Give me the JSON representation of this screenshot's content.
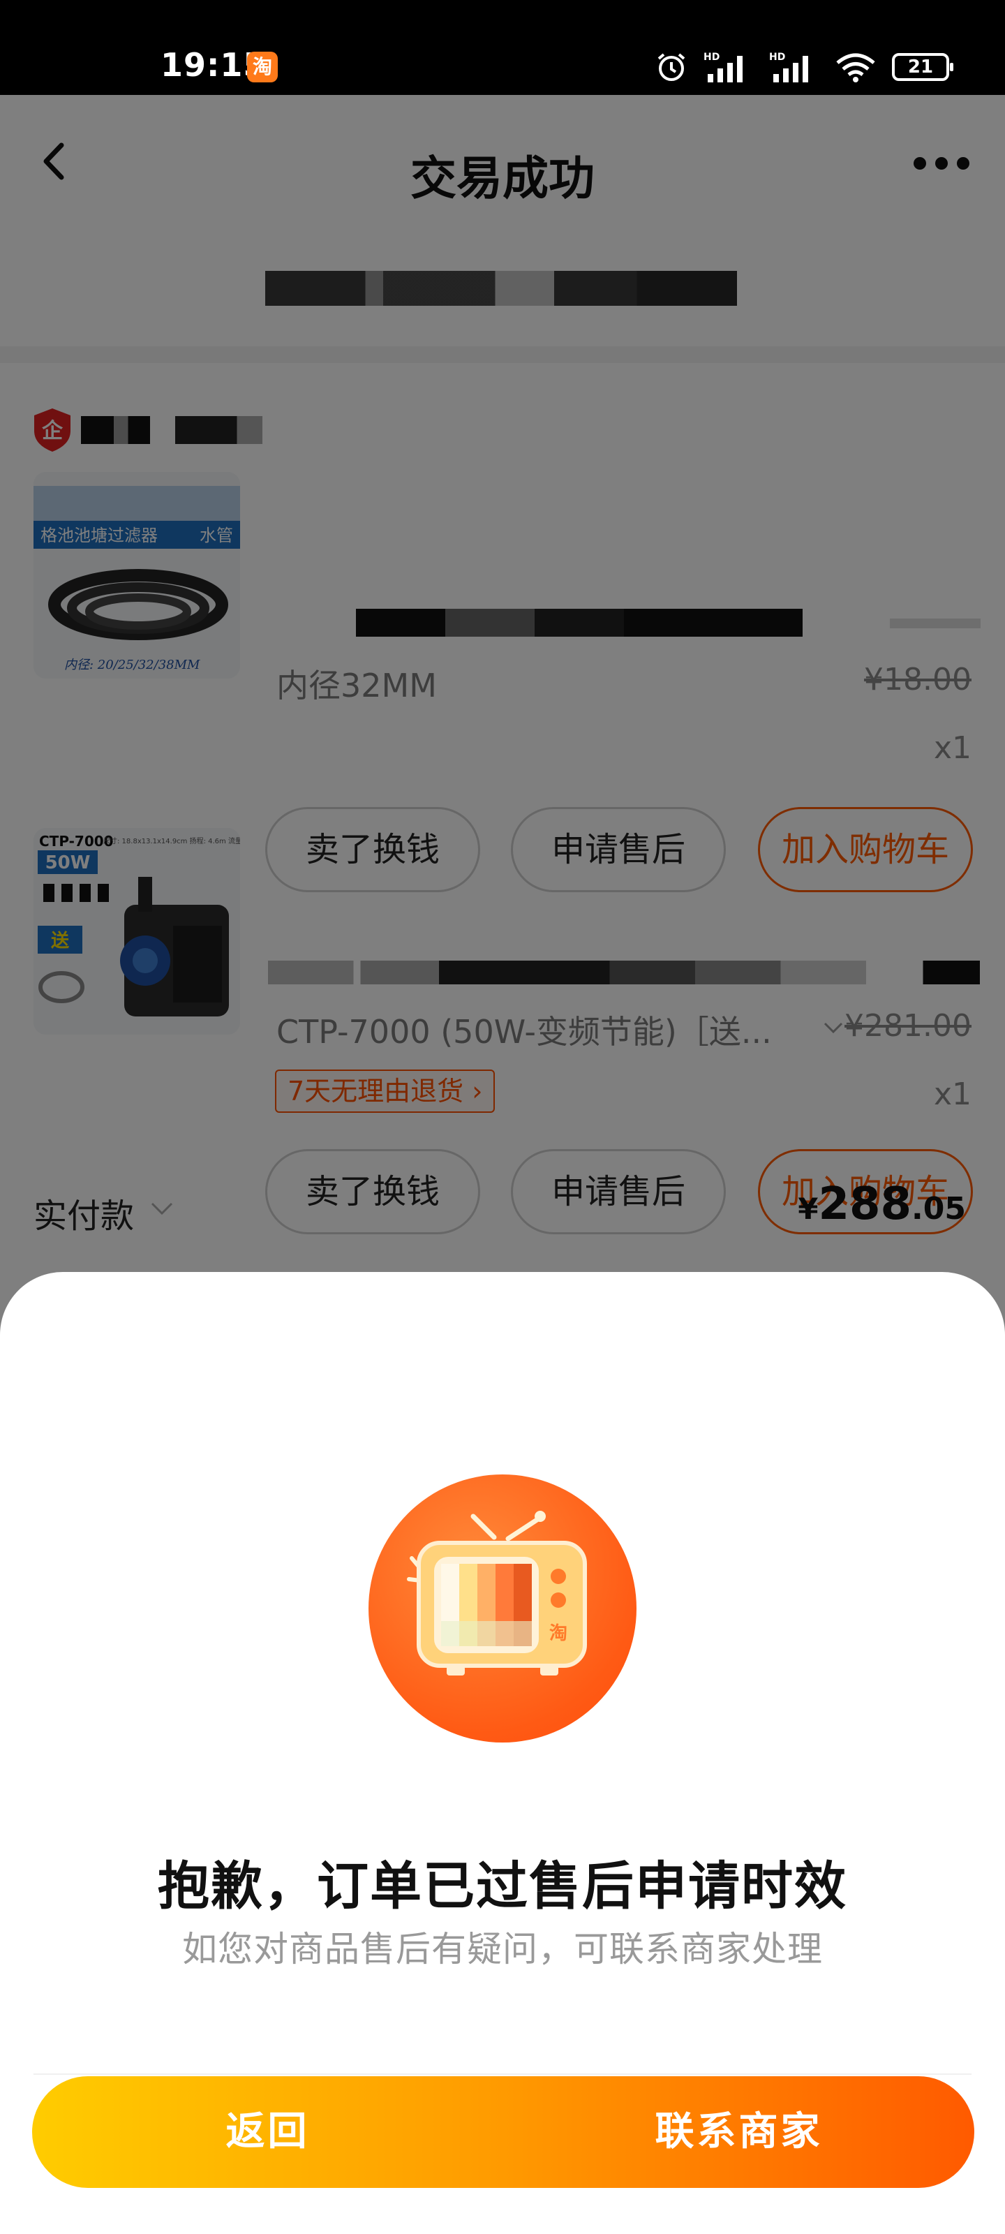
{
  "status_bar": {
    "time": "19:15",
    "app_icon_glyph": "淘",
    "battery": "21",
    "icons": [
      "alarm-icon",
      "signal-hd-icon",
      "signal-hd-icon",
      "wifi-icon",
      "battery-icon"
    ]
  },
  "nav": {
    "title": "交易成功",
    "back_icon": "chevron-left-icon",
    "more_icon": "more-dots-icon"
  },
  "shop": {
    "badge_text": "企"
  },
  "items": [
    {
      "thumb_banner": "格池池塘过滤器",
      "thumb_tag": "水管",
      "thumb_caption": "内径: 20/25/32/38MM",
      "spec": "内径32MM",
      "price": "¥18.00",
      "qty": "x1",
      "buttons": [
        "卖了换钱",
        "申请售后",
        "加入购物车"
      ]
    },
    {
      "thumb_model": "CTP-7000",
      "thumb_power": "50W",
      "thumb_gift": "送",
      "thumb_specs": "尺寸: 18.8x13.1x14.9cm 扬程: 4.6m 流量: 7000L/h 电源线: 约5m",
      "spec": "CTP-7000 (50W-变频节能)［送...",
      "price": "¥281.00",
      "return_tag": "7天无理由退货",
      "qty": "x1",
      "buttons": [
        "卖了换钱",
        "申请售后",
        "加入购物车"
      ]
    }
  ],
  "paid": {
    "label": "实付款",
    "currency": "¥",
    "integer": "288",
    "decimal": ".05"
  },
  "sheet": {
    "icon": "tv-icon",
    "title": "抱歉，订单已过售后申请时效",
    "subtitle": "如您对商品售后有疑问，可联系商家处理",
    "back_label": "返回",
    "contact_label": "联系商家"
  },
  "colors": {
    "accent": "#ff5000",
    "gradient_start": "#ffcc00",
    "gradient_end": "#ff5a00",
    "overlay": "rgba(0,0,0,0.5)"
  }
}
